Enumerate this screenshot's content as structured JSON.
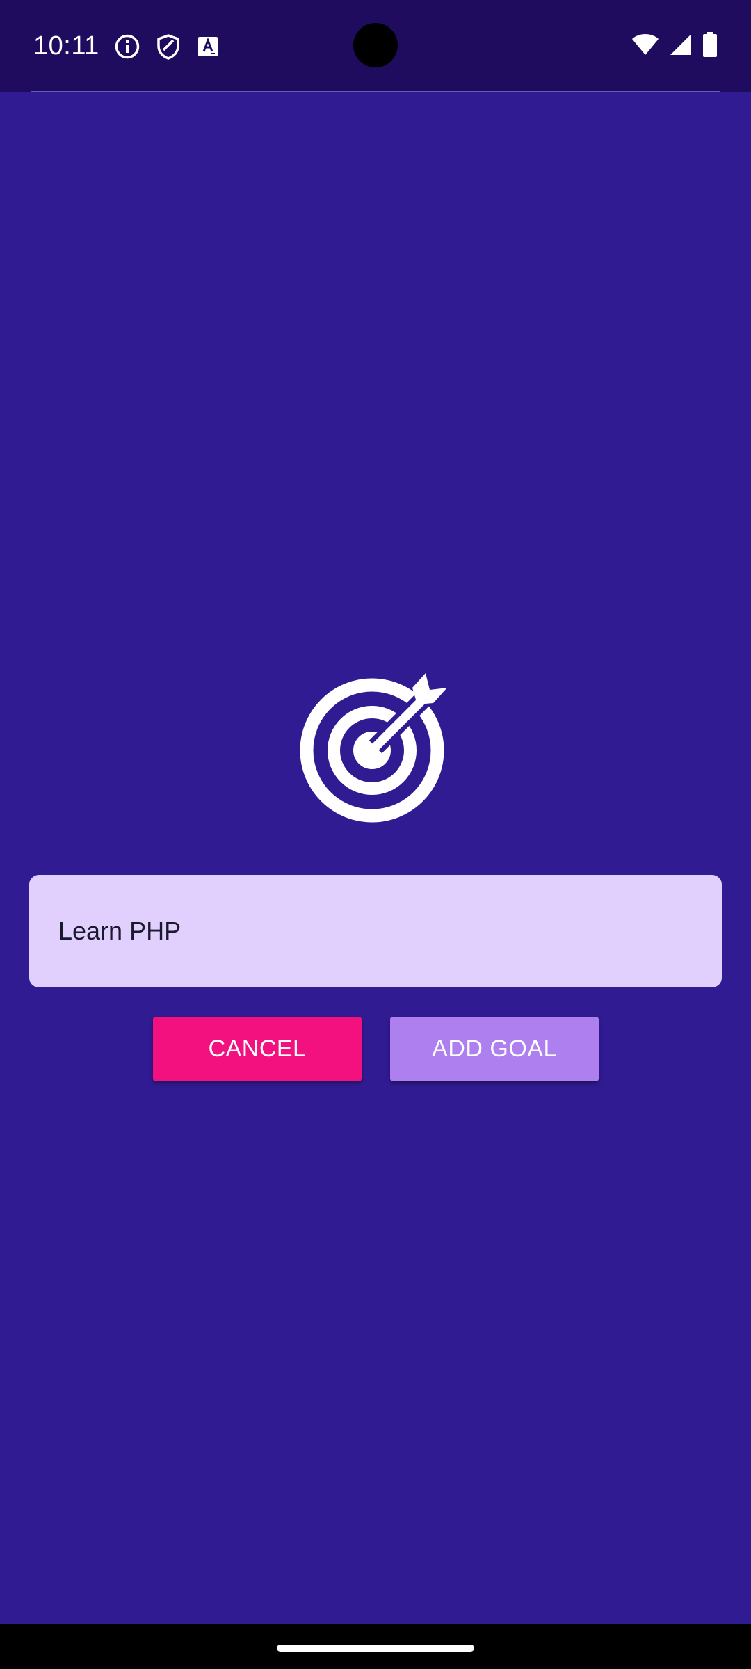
{
  "status_bar": {
    "time": "10:11",
    "left_icons": [
      "info-icon",
      "shield-icon",
      "text-format-icon"
    ],
    "right_icons": [
      "wifi-icon",
      "signal-icon",
      "battery-icon"
    ]
  },
  "main": {
    "icon": "target-arrow-icon",
    "goal_input": {
      "value": "Learn PHP",
      "placeholder": ""
    },
    "cancel_label": "CANCEL",
    "add_goal_label": "ADD GOAL"
  },
  "colors": {
    "background": "#311b92",
    "status_bar": "#1f0c5e",
    "input_background": "#e1cffd",
    "cancel_button": "#f2117f",
    "add_goal_button": "#ad7fef"
  }
}
